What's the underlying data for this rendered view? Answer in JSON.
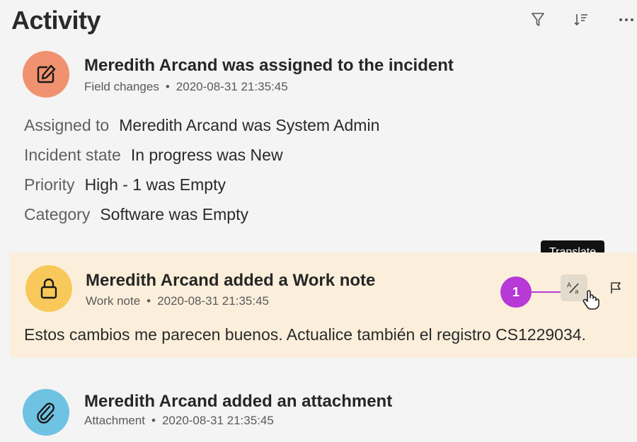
{
  "header": {
    "title": "Activity",
    "icons": [
      "filter-icon",
      "sort-icon",
      "more-icon"
    ]
  },
  "entries": [
    {
      "title": "Meredith Arcand was assigned to the incident",
      "type": "Field changes",
      "separator": "•",
      "timestamp": "2020-08-31 21:35:45",
      "icon": "edit-icon",
      "icon_color": "#f0926f",
      "changes": [
        {
          "label": "Assigned to",
          "value": "Meredith Arcand was System Admin"
        },
        {
          "label": "Incident state",
          "value": "In progress was New"
        },
        {
          "label": "Priority",
          "value": "High - 1 was Empty"
        },
        {
          "label": "Category",
          "value": "Software was Empty"
        }
      ]
    },
    {
      "title": "Meredith Arcand added a Work note",
      "type": "Work note",
      "separator": "•",
      "timestamp": "2020-08-31 21:35:45",
      "icon": "lock-icon",
      "icon_color": "#f8c95a",
      "background": "#fbefdb",
      "text": "Estos cambios me parecen buenos. Actualice también el registro CS1229034.",
      "actions": [
        "translate-icon",
        "flag-icon"
      ]
    },
    {
      "title": "Meredith Arcand added an attachment",
      "type": "Attachment",
      "separator": "•",
      "timestamp": "2020-08-31 21:35:45",
      "icon": "paperclip-icon",
      "icon_color": "#6ec3e3"
    }
  ],
  "tooltip": {
    "text": "Translate"
  },
  "step_marker": {
    "number": "1",
    "color": "#b739d6"
  }
}
